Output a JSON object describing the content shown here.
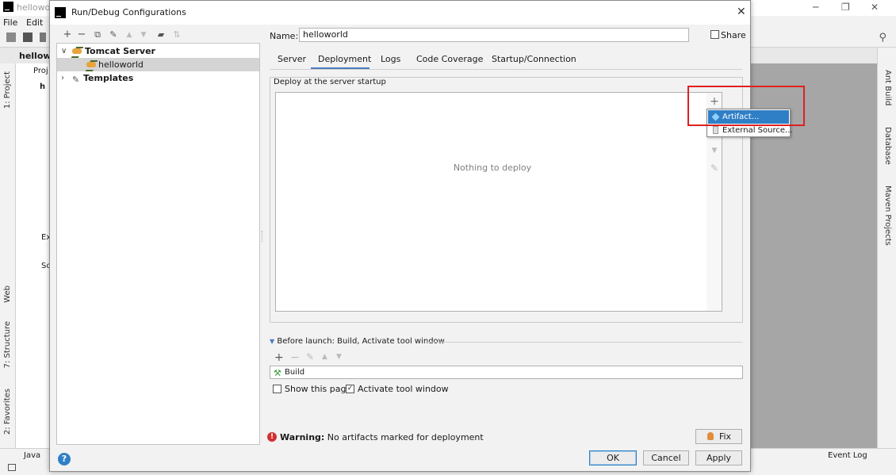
{
  "ide": {
    "title": "hellowor",
    "menu": {
      "file": "File",
      "edit": "Edit"
    },
    "breadcrumb": "hellowo",
    "left_tabs": {
      "project": "1: Project",
      "web": "Web",
      "structure": "7: Structure",
      "favorites": "2: Favorites"
    },
    "right_tabs": {
      "ant_build": "Ant Build",
      "database": "Database",
      "maven": "Maven Projects"
    },
    "status": {
      "java": "Java",
      "event_log": "Event Log"
    },
    "project_items": [
      "Proj",
      "h",
      "Ex",
      "Sc"
    ]
  },
  "dialog": {
    "title": "Run/Debug Configurations",
    "close_glyph": "✕",
    "tree": {
      "groups": [
        {
          "label": "Tomcat Server",
          "expanded": true,
          "children": [
            "helloworld"
          ]
        },
        {
          "label": "Templates",
          "expanded": false
        }
      ]
    },
    "name_label": "Name:",
    "name_value": "helloworld",
    "share_label": "Share",
    "tabs": [
      "Server",
      "Deployment",
      "Logs",
      "Code Coverage",
      "Startup/Connection"
    ],
    "active_tab": "Deployment",
    "deploy": {
      "group_title": "Deploy at the server startup",
      "empty_text": "Nothing to deploy",
      "popup_items": [
        "Artifact...",
        "External Source..."
      ]
    },
    "before_launch": {
      "title": "Before launch: Build, Activate tool window",
      "tasks": [
        "Build"
      ],
      "show_page_label": "Show this page",
      "show_page_checked": false,
      "activate_label": "Activate tool window",
      "activate_checked": true
    },
    "warning": {
      "prefix": "Warning:",
      "message": "No artifacts marked for deployment",
      "fix_label": "Fix"
    },
    "buttons": {
      "ok": "OK",
      "cancel": "Cancel",
      "apply": "Apply"
    },
    "colors": {
      "selection": "#2f7fc6",
      "highlight": "#e02020",
      "warning": "#d23131"
    }
  }
}
